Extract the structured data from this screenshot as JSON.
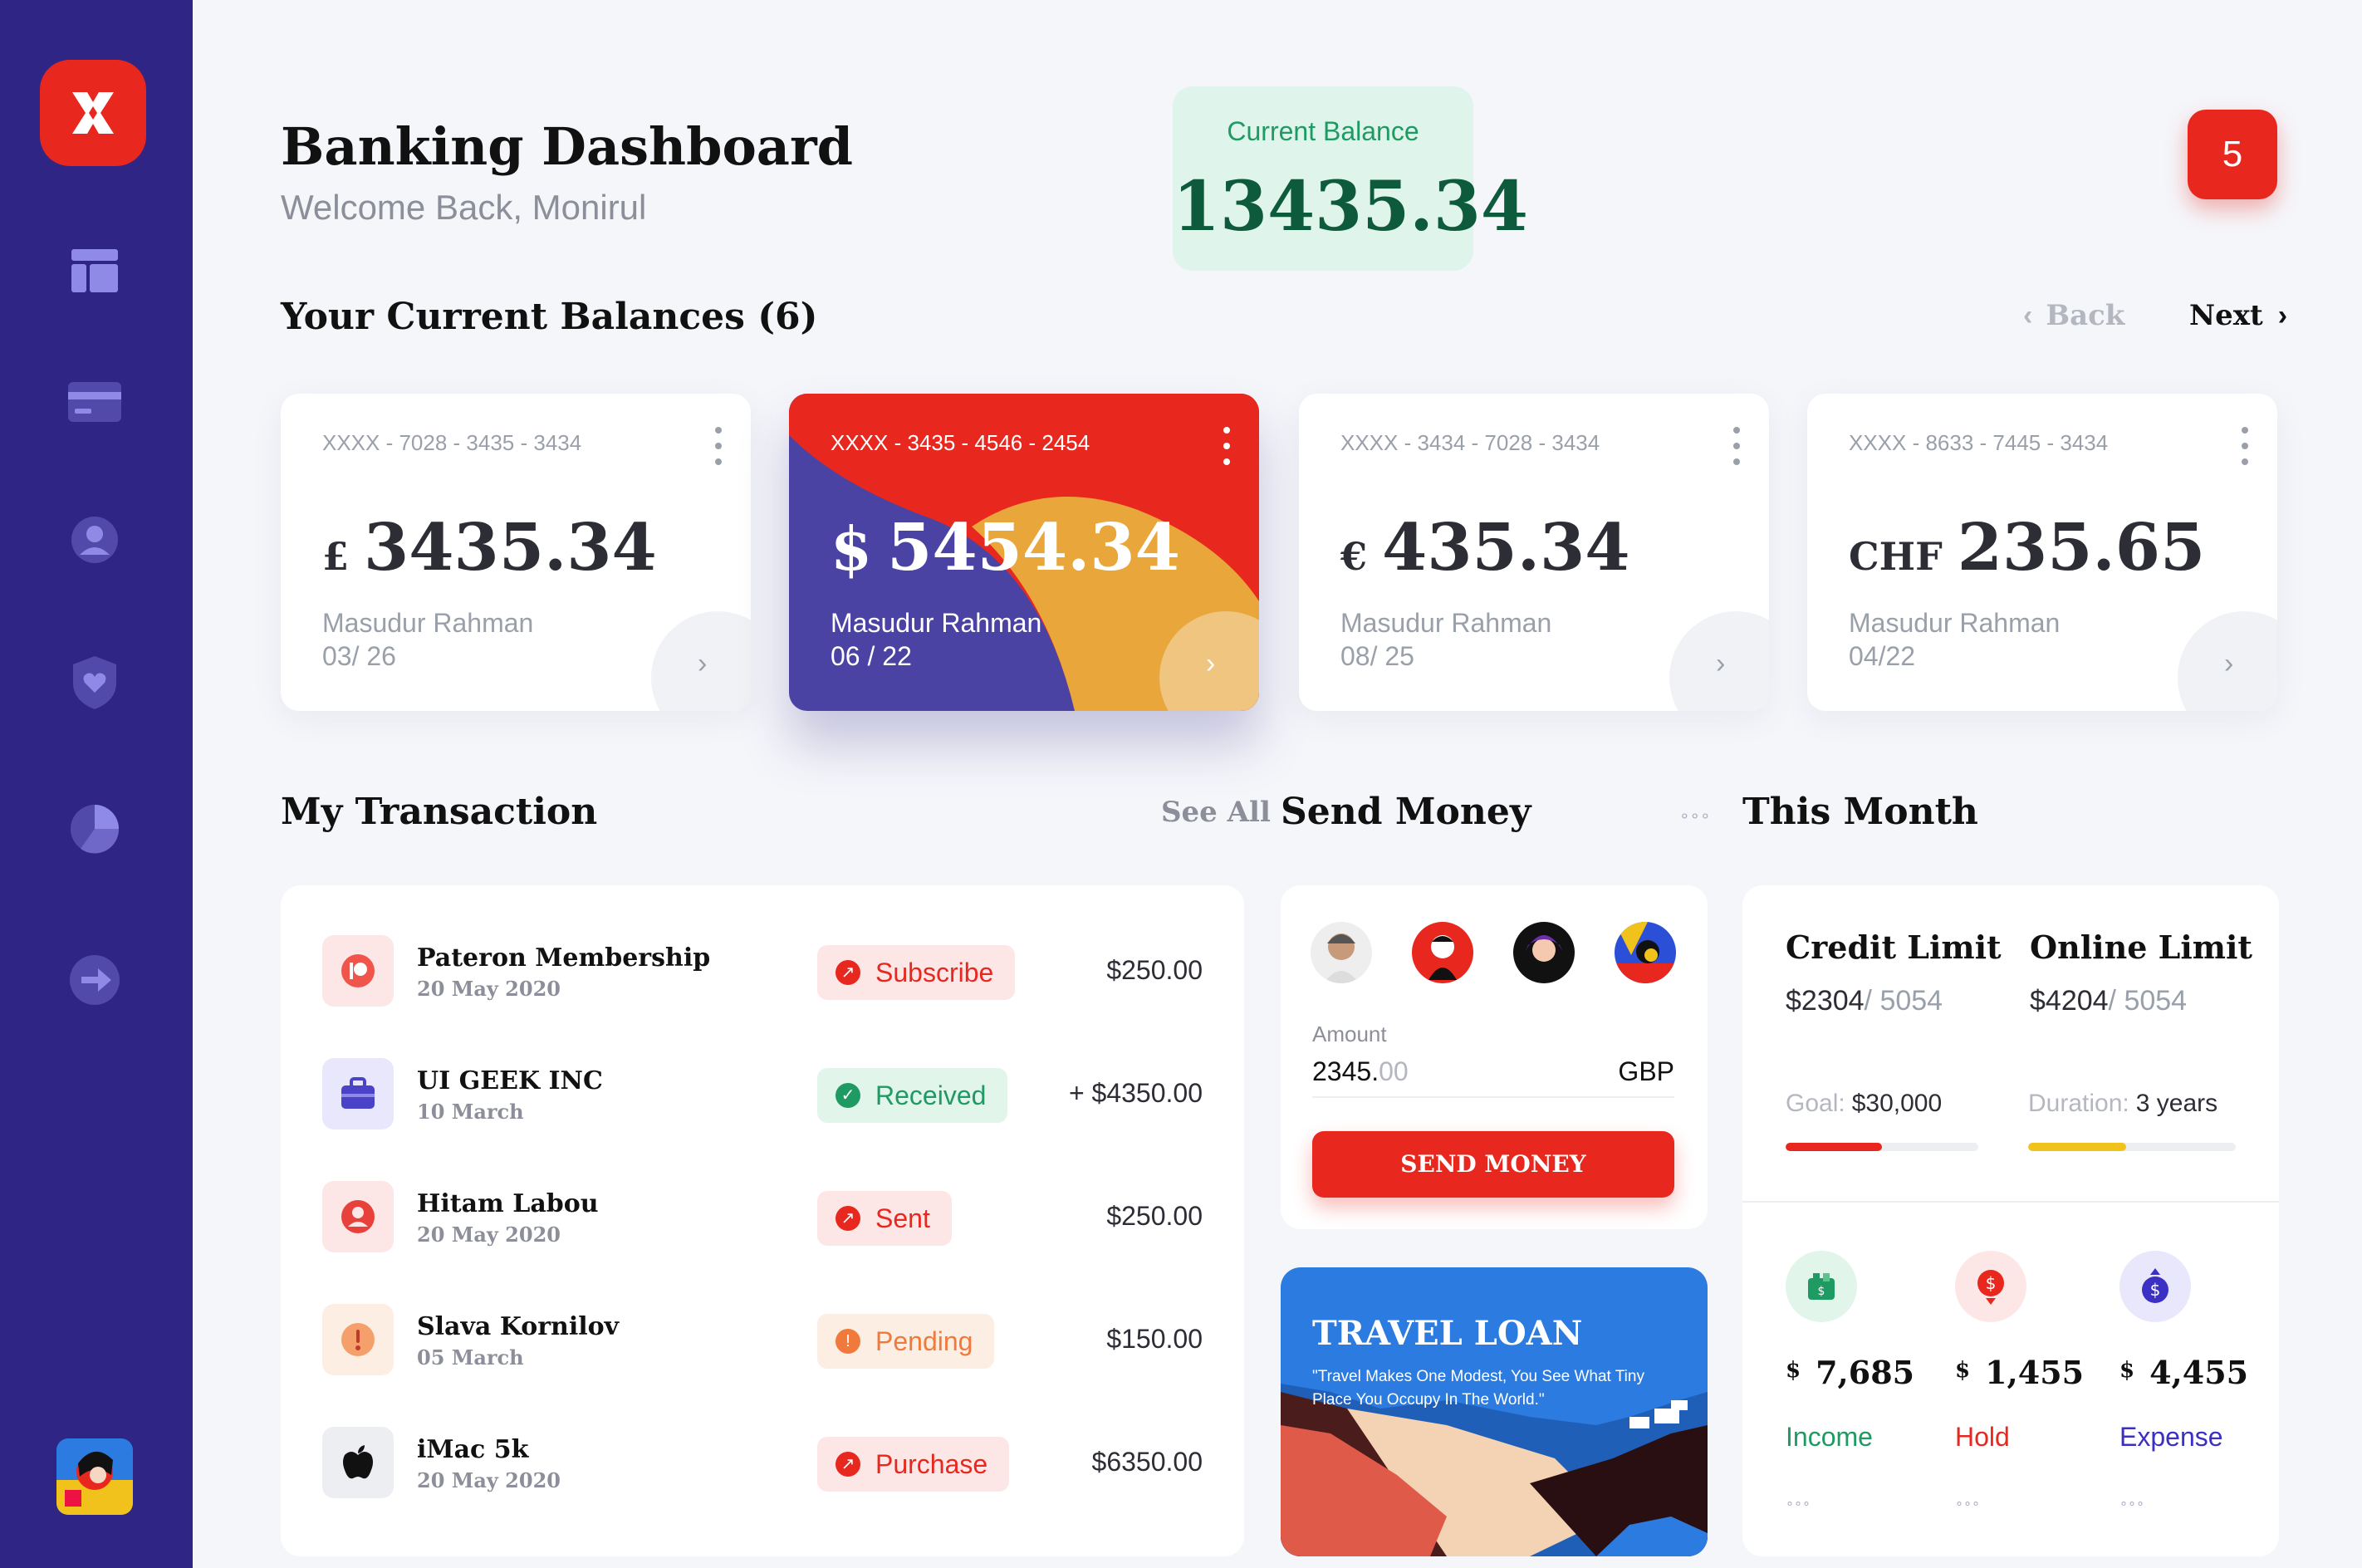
{
  "header": {
    "title": "Banking Dashboard",
    "subtitle": "Welcome Back, Monirul",
    "current_balance_label": "Current Balance",
    "current_balance_value": "13435.34",
    "notification_count": "5"
  },
  "sidebar": {
    "items": [
      {
        "icon": "dashboard-icon"
      },
      {
        "icon": "card-icon"
      },
      {
        "icon": "user-icon"
      },
      {
        "icon": "shield-heart-icon"
      },
      {
        "icon": "pie-chart-icon"
      },
      {
        "icon": "logout-icon"
      }
    ]
  },
  "balances": {
    "title": "Your Current Balances (6)",
    "back_label": "Back",
    "next_label": "Next",
    "cards": [
      {
        "number": "XXXX - 7028 - 3435 - 3434",
        "currency": "£",
        "amount": "3435.34",
        "owner": "Masudur Rahman",
        "expiry": "03/ 26"
      },
      {
        "number": "XXXX - 3435 - 4546 - 2454",
        "currency": "$",
        "amount": "5454.34",
        "owner": "Masudur Rahman",
        "expiry": "06 / 22"
      },
      {
        "number": "XXXX - 3434 - 7028 - 3434",
        "currency": "€",
        "amount": "435.34",
        "owner": "Masudur Rahman",
        "expiry": "08/ 25"
      },
      {
        "number": "XXXX - 8633 - 7445 - 3434",
        "currency": "CHF",
        "amount": "235.65",
        "owner": "Masudur Rahman",
        "expiry": "04/22"
      }
    ]
  },
  "transactions": {
    "title": "My Transaction",
    "see_all": "See All",
    "rows": [
      {
        "name": "Pateron Membership",
        "date": "20 May 2020",
        "status": "Subscribe",
        "amount": "$250.00"
      },
      {
        "name": "UI GEEK INC",
        "date": "10 March",
        "status": "Received",
        "amount": "+ $4350.00"
      },
      {
        "name": "Hitam Labou",
        "date": "20 May 2020",
        "status": "Sent",
        "amount": "$250.00"
      },
      {
        "name": "Slava Kornilov",
        "date": "05 March",
        "status": "Pending",
        "amount": "$150.00"
      },
      {
        "name": "iMac 5k",
        "date": "20 May 2020",
        "status": "Purchase",
        "amount": "$6350.00"
      }
    ]
  },
  "send_money": {
    "title": "Send Money",
    "amount_label": "Amount",
    "amount_int": "2345.",
    "amount_dec": "00",
    "currency": "GBP",
    "button": "SEND MONEY"
  },
  "travel_loan": {
    "title": "TRAVEL LOAN",
    "quote": "\"Travel Makes One Modest, You See What Tiny Place You Occupy In The World.\""
  },
  "this_month": {
    "title": "This Month",
    "credit_limit_label": "Credit Limit",
    "credit_used": "$2304",
    "credit_total": "/ 5054",
    "online_limit_label": "Online Limit",
    "online_used": "$4204",
    "online_total": "/ 5054",
    "goal_label": "Goal:",
    "goal_value": "$30,000",
    "duration_label": "Duration:",
    "duration_value": "3 years",
    "goal_progress": 0.5,
    "duration_progress": 0.47,
    "colors": {
      "goal": "#e8281e",
      "duration": "#f2c21c"
    },
    "stats": [
      {
        "currency": "$",
        "value": "7,685",
        "label": "Income",
        "color": "#1f9a63"
      },
      {
        "currency": "$",
        "value": "1,455",
        "label": "Hold",
        "color": "#e8281e"
      },
      {
        "currency": "$",
        "value": "4,455",
        "label": "Expense",
        "color": "#3b2fc4"
      }
    ]
  }
}
